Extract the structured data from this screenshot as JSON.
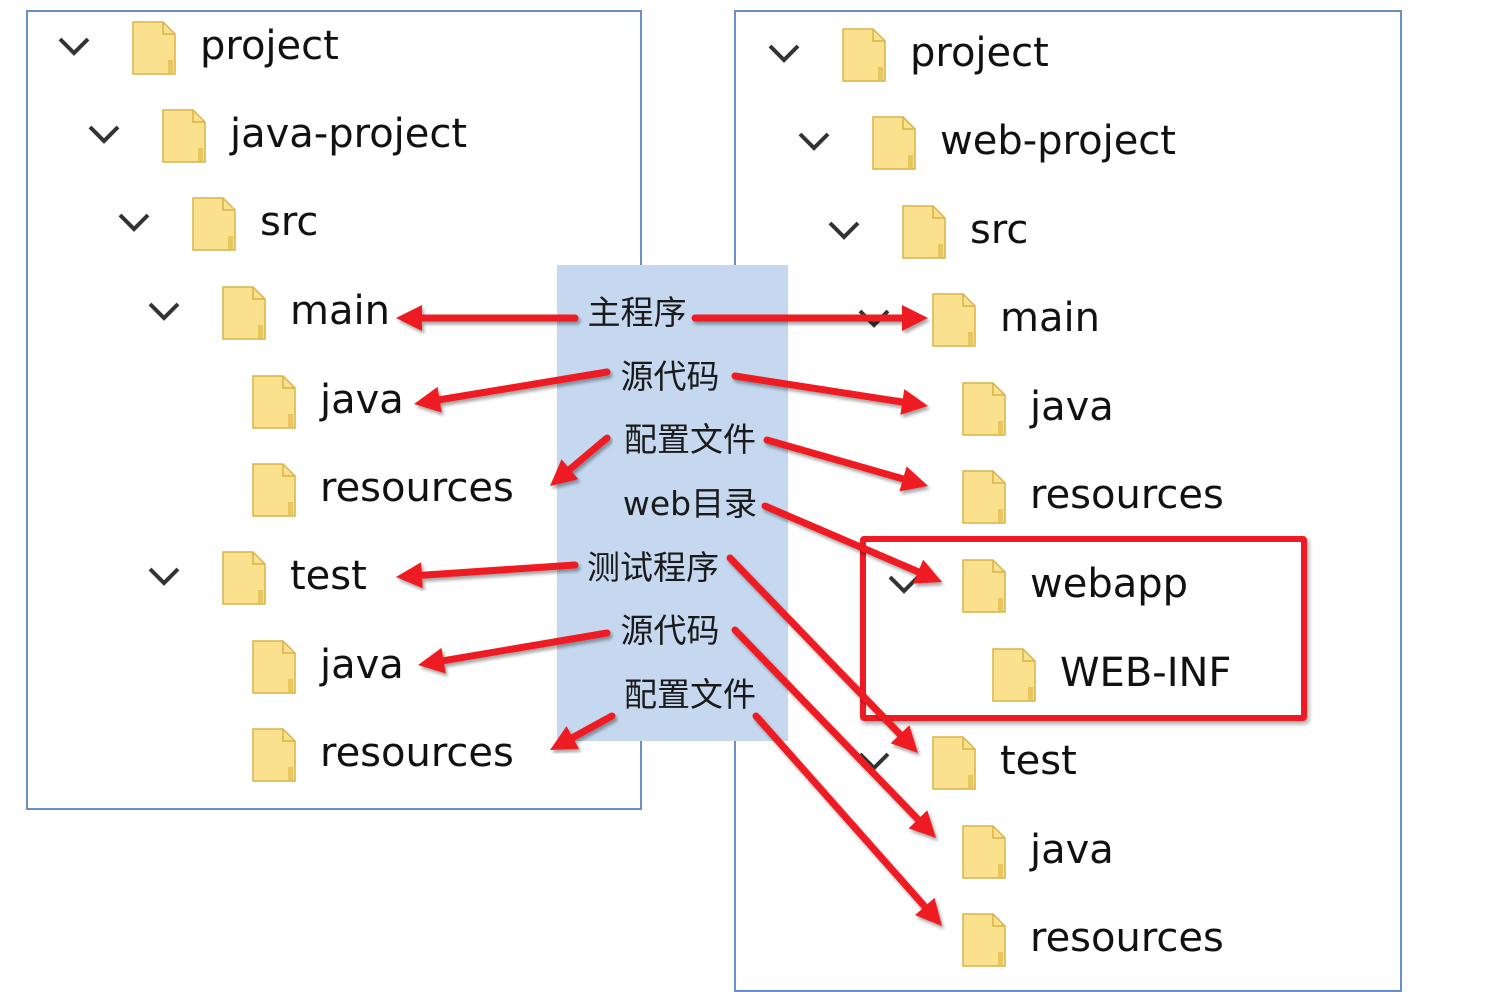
{
  "left_tree": {
    "nodes": [
      {
        "label": "project",
        "expanded": true
      },
      {
        "label": "java-project",
        "expanded": true
      },
      {
        "label": "src",
        "expanded": true
      },
      {
        "label": "main",
        "expanded": true
      },
      {
        "label": "java",
        "expanded": null
      },
      {
        "label": "resources",
        "expanded": null
      },
      {
        "label": "test",
        "expanded": true
      },
      {
        "label": "java",
        "expanded": null
      },
      {
        "label": "resources",
        "expanded": null
      }
    ]
  },
  "right_tree": {
    "nodes": [
      {
        "label": "project",
        "expanded": true
      },
      {
        "label": "web-project",
        "expanded": true
      },
      {
        "label": "src",
        "expanded": true
      },
      {
        "label": "main",
        "expanded": true
      },
      {
        "label": "java",
        "expanded": null
      },
      {
        "label": "resources",
        "expanded": null
      },
      {
        "label": "webapp",
        "expanded": true
      },
      {
        "label": "WEB-INF",
        "expanded": null
      },
      {
        "label": "test",
        "expanded": true
      },
      {
        "label": "java",
        "expanded": null
      },
      {
        "label": "resources",
        "expanded": null
      }
    ]
  },
  "labels": [
    {
      "text": "主程序"
    },
    {
      "text": "源代码"
    },
    {
      "text": "配置文件"
    },
    {
      "text": "web目录"
    },
    {
      "text": "测试程序"
    },
    {
      "text": "源代码"
    },
    {
      "text": "配置文件"
    }
  ],
  "colors": {
    "arrow": "#ee1b24",
    "highlight_border": "#ee1b24",
    "panel_border": "#6a8fc4",
    "label_band": "#c5d8ef",
    "folder_fill": "#fbe08d",
    "folder_edge": "#d8b24a"
  },
  "icons": {
    "folder": "folder-icon",
    "chevron": "chevron-down-icon"
  }
}
